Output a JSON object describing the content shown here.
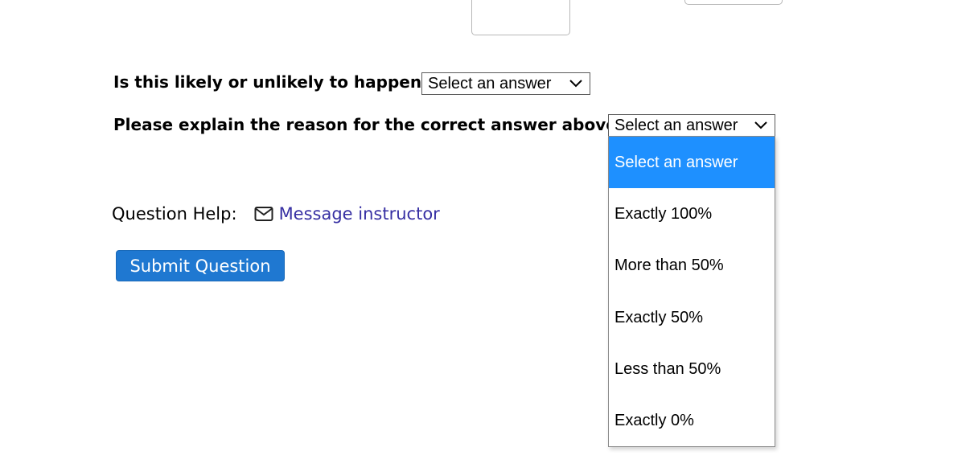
{
  "questions": [
    {
      "label": "Is this likely or unlikely to happen?",
      "selected": "Select an answer"
    },
    {
      "label": "Please explain the reason for the correct answer above.",
      "selected": "Select an answer",
      "open": true,
      "options": [
        "Select an answer",
        "Exactly 100%",
        "More than 50%",
        "Exactly 50%",
        "Less than 50%",
        "Exactly 0%"
      ],
      "highlighted_option": "Select an answer"
    }
  ],
  "help": {
    "label": "Question Help:",
    "link_text": "Message instructor",
    "icon": "mail-icon"
  },
  "submit": {
    "label": "Submit Question"
  },
  "colors": {
    "highlight": "#1e90ff",
    "button": "#1f78d1",
    "link": "#3730a3"
  }
}
